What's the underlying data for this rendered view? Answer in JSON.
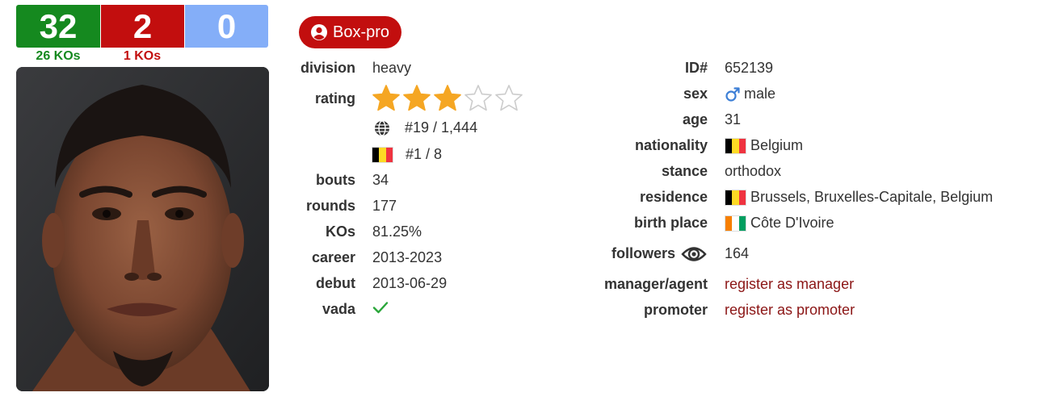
{
  "record": {
    "wins": "32",
    "losses": "2",
    "draws": "0",
    "win_kos": "26 KOs",
    "loss_kos": "1 KOs"
  },
  "badge": {
    "label": "Box-pro",
    "icon": "user-circle-icon"
  },
  "left": {
    "division": {
      "label": "division",
      "value": "heavy"
    },
    "rating": {
      "label": "rating",
      "stars": 3,
      "max_stars": 5
    },
    "world_rank": "#19 / 1,444",
    "country_rank": "#1 / 8",
    "bouts": {
      "label": "bouts",
      "value": "34"
    },
    "rounds": {
      "label": "rounds",
      "value": "177"
    },
    "kos": {
      "label": "KOs",
      "value": "81.25%"
    },
    "career": {
      "label": "career",
      "value": "2013-2023"
    },
    "debut": {
      "label": "debut",
      "value": "2013-06-29"
    },
    "vada": {
      "label": "vada",
      "icon": "checkmark-icon"
    }
  },
  "right": {
    "id": {
      "label": "ID#",
      "value": "652139"
    },
    "sex": {
      "label": "sex",
      "value": "male"
    },
    "age": {
      "label": "age",
      "value": "31"
    },
    "nationality": {
      "label": "nationality",
      "value": "Belgium"
    },
    "stance": {
      "label": "stance",
      "value": "orthodox"
    },
    "residence": {
      "label": "residence",
      "value": "Brussels, Bruxelles-Capitale, Belgium"
    },
    "birth_place": {
      "label": "birth place",
      "value": "Côte D'Ivoire"
    },
    "followers": {
      "label": "followers",
      "value": "164"
    },
    "manager": {
      "label": "manager/agent",
      "value": "register as manager"
    },
    "promoter": {
      "label": "promoter",
      "value": "register as promoter"
    }
  },
  "colors": {
    "win": "#15891f",
    "loss": "#c20e0e",
    "draw": "#84aef8",
    "star": "#f5a623",
    "link": "#8b1515",
    "male": "#3d7fd6"
  }
}
